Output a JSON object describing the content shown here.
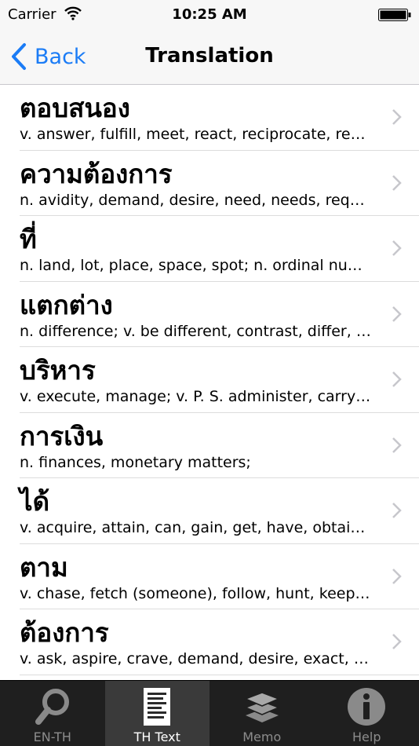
{
  "status": {
    "carrier": "Carrier",
    "time": "10:25 AM"
  },
  "nav": {
    "back_label": "Back",
    "title": "Translation"
  },
  "entries": [
    {
      "thai": "ตอบสนอง",
      "meaning": "v. answer, fulfill, meet, react, reciprocate, reco…"
    },
    {
      "thai": "ความต้องการ",
      "meaning": "n. avidity, demand, desire, need, needs, reque…"
    },
    {
      "thai": "ที่",
      "meaning": "n. land, lot, place, space, spot; n. ordinal num…"
    },
    {
      "thai": "แตกต่าง",
      "meaning": "n. difference; v. be different, contrast, differ, di…"
    },
    {
      "thai": "บริหาร",
      "meaning": "v. execute, manage; v. P. S. administer, carry…"
    },
    {
      "thai": "การเงิน",
      "meaning": "n. finances, monetary matters;"
    },
    {
      "thai": "ได้",
      "meaning": "v. acquire, attain, can, gain, get, have, obtain,…"
    },
    {
      "thai": "ตาม",
      "meaning": "v. chase, fetch (someone), follow, hunt, keep a…"
    },
    {
      "thai": "ต้องการ",
      "meaning": "v. ask, aspire, crave, demand, desire, exact, li…"
    }
  ],
  "tabs": [
    {
      "label": "EN-TH",
      "icon": "search-icon",
      "active": false
    },
    {
      "label": "TH Text",
      "icon": "document-icon",
      "active": true
    },
    {
      "label": "Memo",
      "icon": "layers-icon",
      "active": false
    },
    {
      "label": "Help",
      "icon": "info-icon",
      "active": false
    }
  ],
  "colors": {
    "accent": "#1b7cf6",
    "tabbar": "#1f1f1f",
    "tab_active": "#3a3a3a"
  }
}
